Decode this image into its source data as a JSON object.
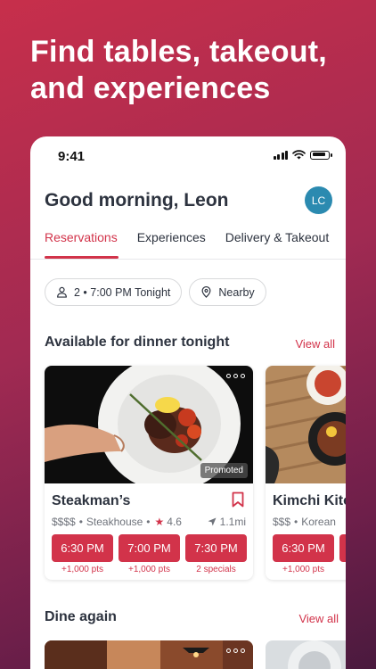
{
  "headline": "Find tables, takeout, and experiences",
  "status": {
    "time": "9:41"
  },
  "greeting": "Good morning, Leon",
  "avatar": "LC",
  "tabs": [
    {
      "label": "Reservations",
      "active": true
    },
    {
      "label": "Experiences",
      "active": false
    },
    {
      "label": "Delivery & Takeout",
      "active": false
    }
  ],
  "filters": {
    "party": "2 • 7:00 PM Tonight",
    "location": "Nearby"
  },
  "available": {
    "title": "Available for dinner tonight",
    "view_all": "View all",
    "restaurants": [
      {
        "name": "Steakman’s",
        "price": "$$$$",
        "cuisine": "Steakhouse",
        "rating": "4.6",
        "distance": "1.1mi",
        "badge": "Promoted",
        "slots": [
          {
            "time": "6:30 PM",
            "note": "+1,000 pts"
          },
          {
            "time": "7:00 PM",
            "note": "+1,000 pts"
          },
          {
            "time": "7:30 PM",
            "note": "2 specials"
          }
        ]
      },
      {
        "name": "Kimchi Kitc",
        "price": "$$$",
        "cuisine": "Korean",
        "slots": [
          {
            "time": "6:30 PM",
            "note": "+1,000 pts"
          }
        ]
      }
    ]
  },
  "dine_again": {
    "title": "Dine again",
    "view_all": "View all"
  },
  "colors": {
    "brand": "#d2334a",
    "avatar": "#2b8ab0"
  }
}
